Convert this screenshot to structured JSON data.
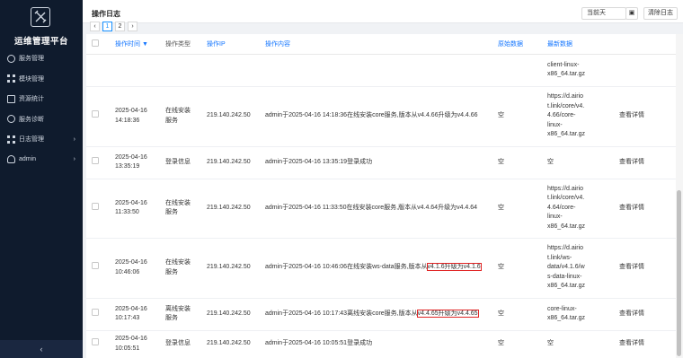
{
  "app": {
    "title": "运维管理平台"
  },
  "sidebar": {
    "items": [
      {
        "label": "服务管理",
        "icon": "gear-icon",
        "expandable": false
      },
      {
        "label": "模块管理",
        "icon": "grid-icon",
        "expandable": false
      },
      {
        "label": "资源统计",
        "icon": "box-icon",
        "expandable": false
      },
      {
        "label": "服务诊断",
        "icon": "gear-icon",
        "expandable": false
      },
      {
        "label": "日志管理",
        "icon": "grid-icon",
        "expandable": true
      },
      {
        "label": "admin",
        "icon": "user-icon",
        "expandable": true
      }
    ],
    "collapse_glyph": "‹",
    "arrow_glyph": "›"
  },
  "header": {
    "title": "操作日志",
    "date_filter": "当前天",
    "calendar_glyph": "▣",
    "clear_label": "清除日志"
  },
  "pager": {
    "prev": "‹",
    "pages": [
      "1",
      "2"
    ],
    "next": "›"
  },
  "table": {
    "columns": [
      "操作时间 ▼",
      "操作类型",
      "操作IP",
      "操作内容",
      "原始数据",
      "最新数据"
    ],
    "rows": [
      {
        "time": "",
        "type": "",
        "ip": "",
        "content": "",
        "original": "",
        "latest": "client-linux-\nx86_64.tar.gz",
        "action": ""
      },
      {
        "time": "2025-04-16\n14:18:36",
        "type": "在线安装\n服务",
        "ip": "219.140.242.50",
        "content": "admin于2025-04-16 14:18:36在线安装core服务,版本从v4.4.66升级为v4.4.66",
        "original": "空",
        "latest": "https://d.airio\nt.link/core/v4.\n4.66/core-\nlinux-\nx86_64.tar.gz",
        "action": "查看详情"
      },
      {
        "time": "2025-04-16\n13:35:19",
        "type": "登录信息",
        "ip": "219.140.242.50",
        "content": "admin于2025-04-16 13:35:19登录成功",
        "original": "空",
        "latest": "空",
        "action": "查看详情"
      },
      {
        "time": "2025-04-16\n11:33:50",
        "type": "在线安装\n服务",
        "ip": "219.140.242.50",
        "content": "admin于2025-04-16 11:33:50在线安装core服务,版本从v4.4.64升级为v4.4.64",
        "original": "空",
        "latest": "https://d.airio\nt.link/core/v4.\n4.64/core-\nlinux-\nx86_64.tar.gz",
        "action": "查看详情"
      },
      {
        "time": "2025-04-16\n10:46:06",
        "type": "在线安装\n服务",
        "ip": "219.140.242.50",
        "content": "admin于2025-04-16 10:46:06在线安装ws-data服务,版本从v4.1.6升级为v4.1.6",
        "content_pre": "admin于2025-04-16 10:46:06在线安装ws-data服务,版本从",
        "content_hl": "v4.1.6升级为v4.1.6",
        "original": "空",
        "latest": "https://d.airio\nt.link/ws-\ndata/v4.1.6/w\ns-data-linux-\nx86_64.tar.gz",
        "action": "查看详情"
      },
      {
        "time": "2025-04-16\n10:17:43",
        "type": "离线安装\n服务",
        "ip": "219.140.242.50",
        "content": "admin于2025-04-16 10:17:43离线安装core服务,版本从v4.4.65升级为v4.4.65",
        "content_pre": "admin于2025-04-16 10:17:43离线安装core服务,版本从",
        "content_hl": "v4.4.65升级为v4.4.65",
        "original": "空",
        "latest": "core-linux-\nx86_64.tar.gz",
        "action": "查看详情"
      },
      {
        "time": "2025-04-16\n10:05:51",
        "type": "登录信息",
        "ip": "219.140.242.50",
        "content": "admin于2025-04-16 10:05:51登录成功",
        "original": "空",
        "latest": "空",
        "action": "查看详情"
      }
    ]
  }
}
